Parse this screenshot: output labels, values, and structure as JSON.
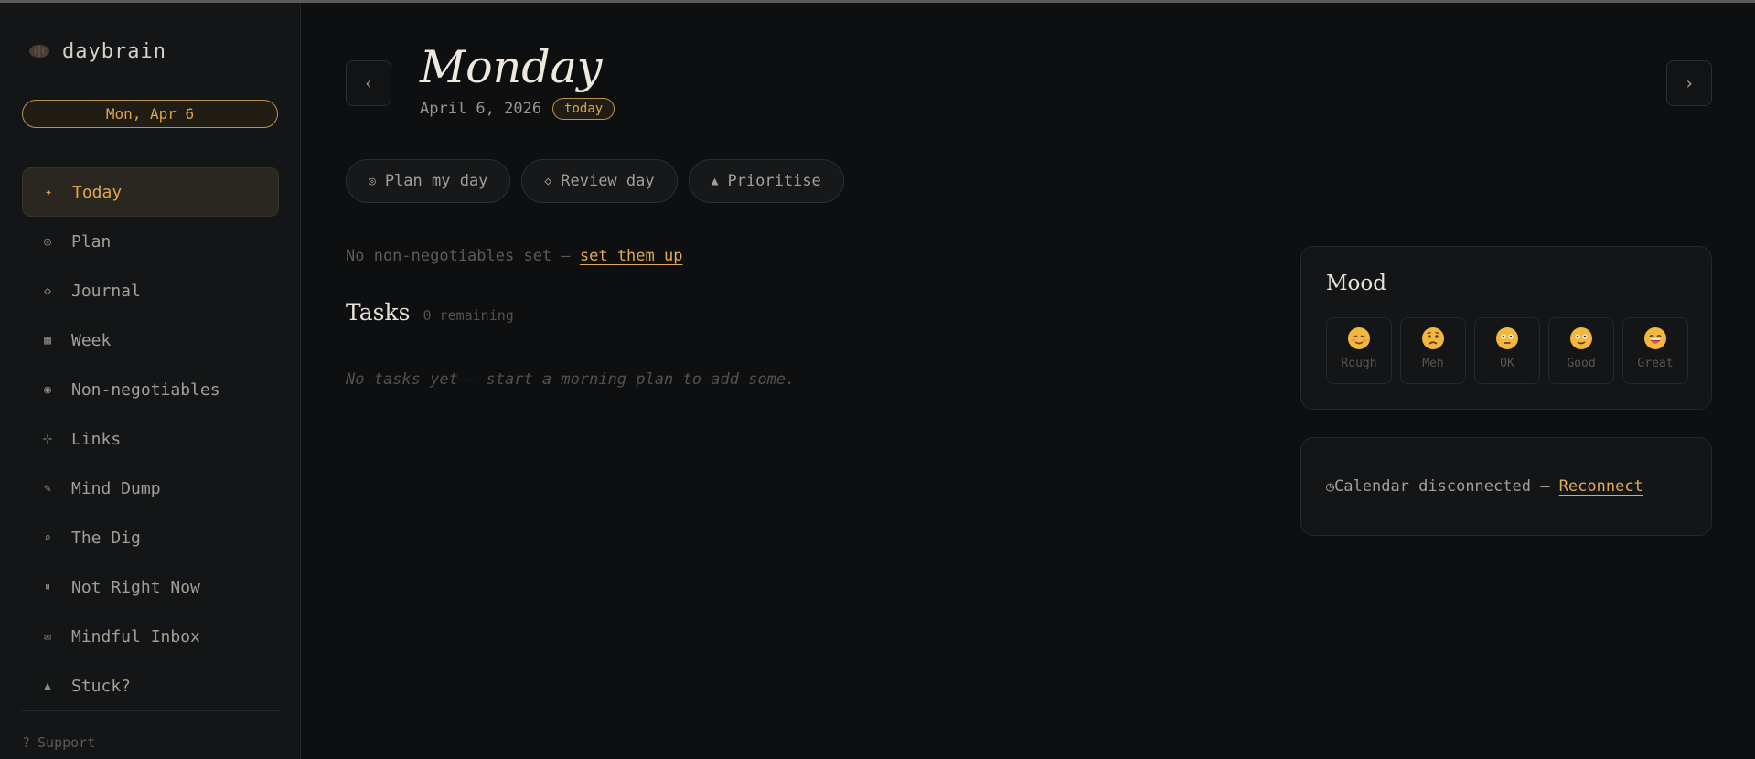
{
  "app": {
    "name": "daybrain",
    "icon": "brain-icon",
    "accent": "#dea651"
  },
  "sidebar": {
    "date_pill": "Mon, Apr 6",
    "items": [
      {
        "label": "Today",
        "icon": "✦",
        "icon_name": "today-icon",
        "active": true
      },
      {
        "label": "Plan",
        "icon": "◎",
        "icon_name": "plan-icon"
      },
      {
        "label": "Journal",
        "icon": "◇",
        "icon_name": "journal-icon"
      },
      {
        "label": "Week",
        "icon": "▦",
        "icon_name": "week-icon"
      },
      {
        "label": "Non-negotiables",
        "icon": "◉",
        "icon_name": "non-negotiables-icon"
      },
      {
        "label": "Links",
        "icon": "⊹",
        "icon_name": "links-icon"
      },
      {
        "label": "Mind Dump",
        "icon": "✎",
        "icon_name": "mind-dump-icon"
      },
      {
        "label": "The Dig",
        "icon": "⌕",
        "icon_name": "the-dig-icon"
      },
      {
        "label": "Not Right Now",
        "icon": "⏸",
        "icon_name": "not-right-now-icon"
      },
      {
        "label": "Mindful Inbox",
        "icon": "✉",
        "icon_name": "mindful-inbox-icon"
      },
      {
        "label": "Stuck?",
        "icon": "▲",
        "icon_name": "stuck-icon"
      }
    ],
    "support_icon": "?",
    "support_label": "Support"
  },
  "header": {
    "prev_icon": "‹",
    "next_icon": "›",
    "day_name": "Monday",
    "full_date": "April 6, 2026",
    "badge": "today"
  },
  "actions": [
    {
      "icon": "◎",
      "label": "Plan my day"
    },
    {
      "icon": "◇",
      "label": "Review day"
    },
    {
      "icon": "▲",
      "label": "Prioritise"
    }
  ],
  "non_negotiables": {
    "text": "No non-negotiables set — ",
    "link": "set them up"
  },
  "tasks": {
    "title": "Tasks",
    "count": "0 remaining",
    "empty": "No tasks yet — start a morning plan to add some."
  },
  "mood": {
    "title": "Mood",
    "options": [
      {
        "label": "Rough",
        "face": "relieved-face"
      },
      {
        "label": "Meh",
        "face": "frowning-face"
      },
      {
        "label": "OK",
        "face": "neutral-face"
      },
      {
        "label": "Good",
        "face": "slightly-smiling-face"
      },
      {
        "label": "Great",
        "face": "grinning-face"
      }
    ]
  },
  "calendar": {
    "icon": "◷",
    "text": "Calendar disconnected — ",
    "link": "Reconnect"
  }
}
